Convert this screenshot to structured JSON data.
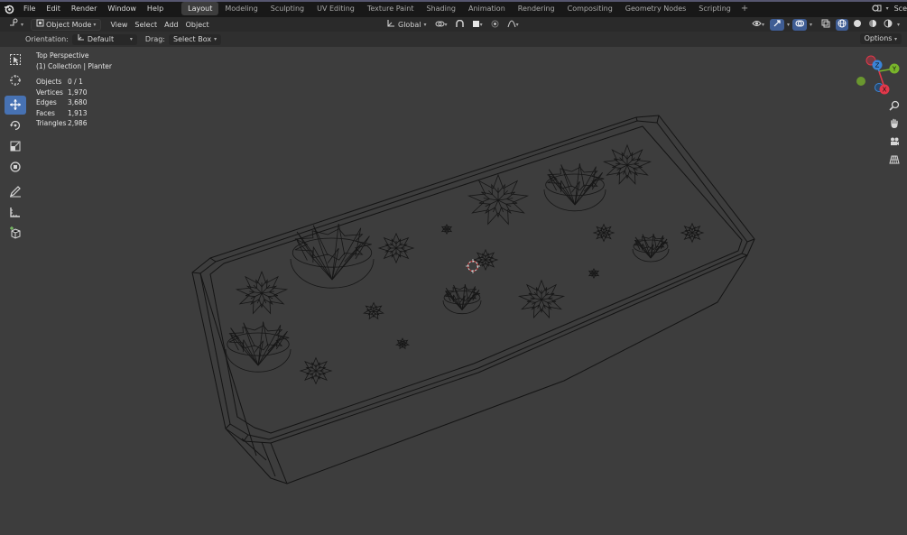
{
  "topbar": {
    "menus": [
      "File",
      "Edit",
      "Render",
      "Window",
      "Help"
    ],
    "workspaces": [
      "Layout",
      "Modeling",
      "Sculpting",
      "UV Editing",
      "Texture Paint",
      "Shading",
      "Animation",
      "Rendering",
      "Compositing",
      "Geometry Nodes",
      "Scripting"
    ],
    "active_workspace": "Layout",
    "scene_label": "Sce"
  },
  "header": {
    "mode": "Object Mode",
    "view": "View",
    "select": "Select",
    "add": "Add",
    "object": "Object",
    "transform_orientation": "Global"
  },
  "toolheader": {
    "orientation_label": "Orientation:",
    "orientation_value": "Default",
    "drag_label": "Drag:",
    "drag_value": "Select Box",
    "options": "Options"
  },
  "viewport": {
    "view_name": "Top Perspective",
    "collection": "(1) Collection | Planter",
    "stats": [
      {
        "label": "Objects",
        "value": "0 / 1"
      },
      {
        "label": "Vertices",
        "value": "1,970"
      },
      {
        "label": "Edges",
        "value": "3,680"
      },
      {
        "label": "Faces",
        "value": "1,913"
      },
      {
        "label": "Triangles",
        "value": "2,986"
      }
    ],
    "gizmo_axes": {
      "x": "X",
      "y": "Y",
      "z": "Z"
    },
    "colors": {
      "x": "#e2384a",
      "y": "#79b52b",
      "z": "#3a84d9",
      "active_tool": "#4772b3"
    }
  },
  "tools": [
    "select-box-tool",
    "cursor-tool",
    "move-tool",
    "rotate-tool",
    "scale-tool",
    "transform-tool",
    "annotate-tool",
    "measure-tool",
    "add-cube-tool"
  ]
}
